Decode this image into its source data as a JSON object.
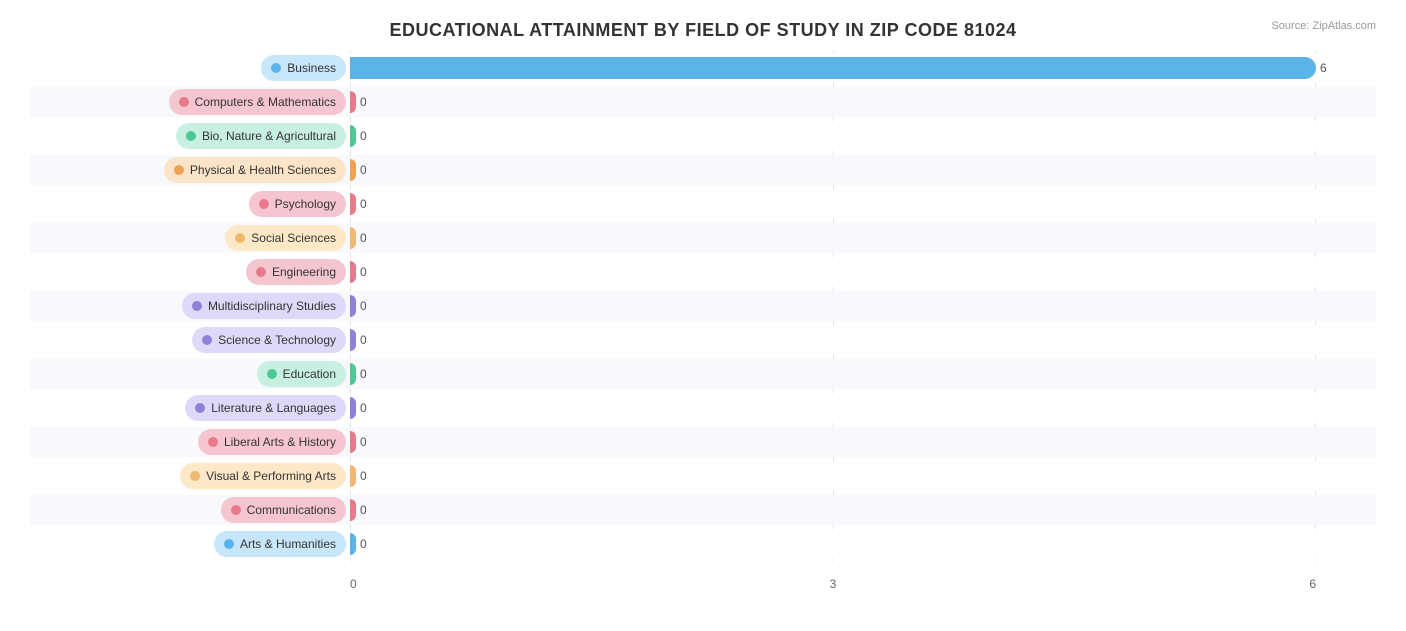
{
  "title": "EDUCATIONAL ATTAINMENT BY FIELD OF STUDY IN ZIP CODE 81024",
  "source": "Source: ZipAtlas.com",
  "xAxis": {
    "labels": [
      "0",
      "3",
      "6"
    ],
    "max": 6
  },
  "bars": [
    {
      "id": "business",
      "label": "Business",
      "value": 6,
      "colorClass": "business"
    },
    {
      "id": "computers",
      "label": "Computers & Mathematics",
      "value": 0,
      "colorClass": "computers"
    },
    {
      "id": "bio",
      "label": "Bio, Nature & Agricultural",
      "value": 0,
      "colorClass": "bio"
    },
    {
      "id": "physical",
      "label": "Physical & Health Sciences",
      "value": 0,
      "colorClass": "physical"
    },
    {
      "id": "psychology",
      "label": "Psychology",
      "value": 0,
      "colorClass": "psychology"
    },
    {
      "id": "social",
      "label": "Social Sciences",
      "value": 0,
      "colorClass": "social"
    },
    {
      "id": "engineering",
      "label": "Engineering",
      "value": 0,
      "colorClass": "engineering"
    },
    {
      "id": "multi",
      "label": "Multidisciplinary Studies",
      "value": 0,
      "colorClass": "multi"
    },
    {
      "id": "science",
      "label": "Science & Technology",
      "value": 0,
      "colorClass": "science"
    },
    {
      "id": "education",
      "label": "Education",
      "value": 0,
      "colorClass": "education"
    },
    {
      "id": "literature",
      "label": "Literature & Languages",
      "value": 0,
      "colorClass": "literature"
    },
    {
      "id": "liberal",
      "label": "Liberal Arts & History",
      "value": 0,
      "colorClass": "liberal"
    },
    {
      "id": "visual",
      "label": "Visual & Performing Arts",
      "value": 0,
      "colorClass": "visual"
    },
    {
      "id": "communications",
      "label": "Communications",
      "value": 0,
      "colorClass": "communications"
    },
    {
      "id": "arts",
      "label": "Arts & Humanities",
      "value": 0,
      "colorClass": "arts"
    }
  ]
}
